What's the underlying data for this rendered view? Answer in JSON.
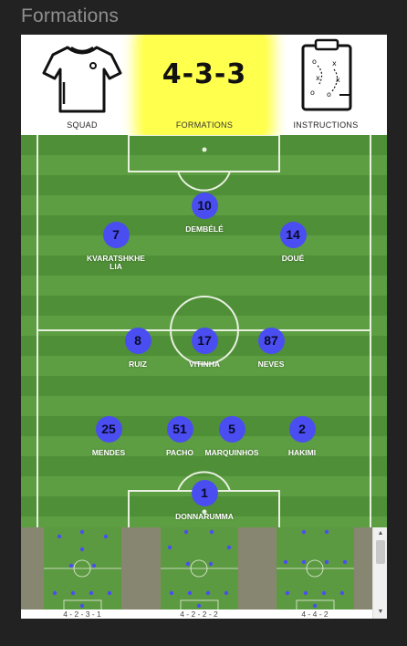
{
  "window": {
    "title": "Formations"
  },
  "tabs": [
    {
      "label": "SQUAD",
      "icon": "shirt-icon"
    },
    {
      "label": "FORMATIONS",
      "value": "4-3-3"
    },
    {
      "label": "INSTRUCTIONS",
      "icon": "tactics-board-icon"
    }
  ],
  "colors": {
    "player": "#4a4ef0",
    "active_tab": "#ffff4d",
    "pitch_dark": "#4f8f37",
    "pitch_light": "#5d9e42"
  },
  "players": [
    {
      "number": "10",
      "name": "DEMBÉLÉ"
    },
    {
      "number": "7",
      "name": "KVARATSHKHE LIA"
    },
    {
      "number": "14",
      "name": "DOUÉ"
    },
    {
      "number": "8",
      "name": "RUIZ"
    },
    {
      "number": "17",
      "name": "VITINHA"
    },
    {
      "number": "87",
      "name": "NEVES"
    },
    {
      "number": "25",
      "name": "MENDES"
    },
    {
      "number": "51",
      "name": "PACHO"
    },
    {
      "number": "5",
      "name": "MARQUINHOS"
    },
    {
      "number": "2",
      "name": "HAKIMI"
    },
    {
      "number": "1",
      "name": "DONNARUMMA"
    }
  ],
  "buttons": {
    "home": "home-icon",
    "bookmark": "bookmark-icon"
  },
  "formation_options": [
    {
      "label": "4 - 2 - 3 - 1"
    },
    {
      "label": "4 - 2 - 2 - 2"
    },
    {
      "label": "4 - 4 - 2"
    }
  ]
}
